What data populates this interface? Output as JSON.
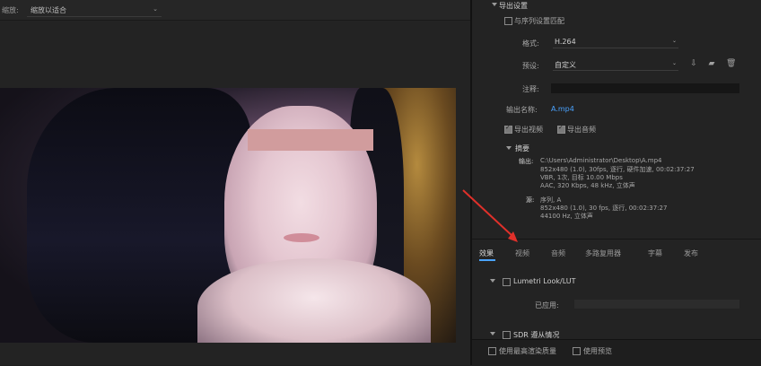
{
  "preview": {
    "fit_label": "缩放:",
    "fit_value": "缩放以适合"
  },
  "export_settings": {
    "section_title": "导出设置",
    "match_sequence_label": "与序列设置匹配",
    "format_label": "格式:",
    "format_value": "H.264",
    "preset_label": "预设:",
    "preset_value": "自定义",
    "comment_label": "注释:",
    "comment_value": "",
    "output_name_label": "输出名称:",
    "output_name_value": "A.mp4",
    "export_video_label": "导出视频",
    "export_audio_label": "导出音频",
    "summary_title": "摘要",
    "output_key": "输出:",
    "output_lines": [
      "C:\\Users\\Administrator\\Desktop\\A.mp4",
      "852x480 (1.0), 30fps, 逐行, 硬件加速, 00:02:37:27",
      "VBR, 1次, 目标 10.00 Mbps",
      "AAC, 320 Kbps, 48 kHz, 立体声"
    ],
    "source_key": "源:",
    "source_lines": [
      "序列, A",
      "852x480 (1.0), 30 fps, 逐行, 00:02:37:27",
      "44100 Hz, 立体声"
    ]
  },
  "tabs": [
    {
      "label": "效果"
    },
    {
      "label": "视频"
    },
    {
      "label": "音频"
    },
    {
      "label": "多路复用器"
    },
    {
      "label": "字幕"
    },
    {
      "label": "发布"
    }
  ],
  "effects": {
    "lumetri_label": "Lumetri Look/LUT",
    "applied_label": "已应用:",
    "sdr_label": "SDR 遵从情况"
  },
  "bottom": {
    "max_render_label": "使用最高渲染质量",
    "use_previews_label": "使用预览"
  },
  "colors": {
    "accent": "#4aa3ff",
    "annotation_arrow": "#e0302a"
  }
}
